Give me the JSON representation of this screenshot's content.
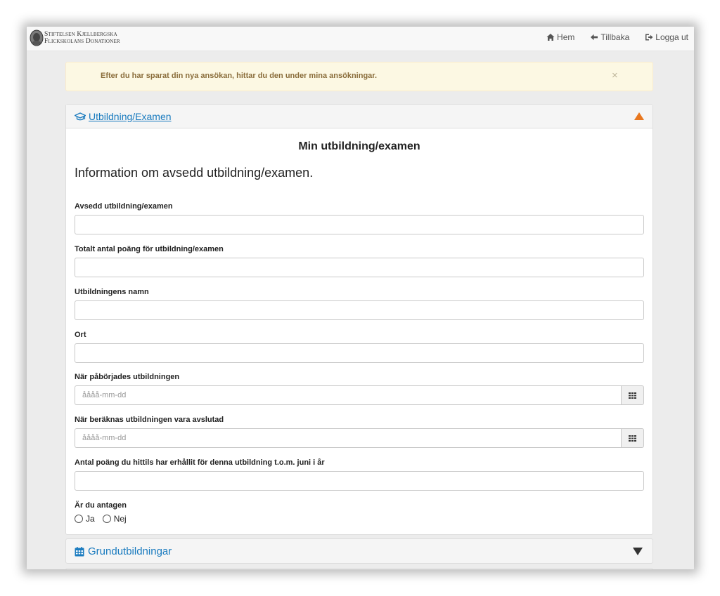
{
  "navbar": {
    "brand_line1": "Stiftelsen Kjellbergska",
    "brand_line2": "Flickskolans Donationer",
    "links": [
      {
        "label": "Hem",
        "icon": "home-icon"
      },
      {
        "label": "Tillbaka",
        "icon": "arrow-left-icon"
      },
      {
        "label": "Logga ut",
        "icon": "logout-icon"
      }
    ]
  },
  "alert": {
    "text": "Efter du har sparat din nya ansökan, hittar du den under mina ansökningar.",
    "close": "×"
  },
  "panel_education": {
    "title": "Utbildning/Examen",
    "icon": "graduation-cap-icon",
    "section_title": "Min utbildning/examen",
    "lead": "Information om avsedd utbildning/examen.",
    "fields": {
      "intended": {
        "label": "Avsedd utbildning/examen",
        "value": ""
      },
      "total_points": {
        "label": "Totalt antal poäng för utbildning/examen",
        "value": ""
      },
      "name": {
        "label": "Utbildningens namn",
        "value": ""
      },
      "city": {
        "label": "Ort",
        "value": ""
      },
      "start": {
        "label": "När påbörjades utbildningen",
        "placeholder": "åååå-mm-dd"
      },
      "end": {
        "label": "När beräknas utbildningen vara avslutad",
        "placeholder": "åååå-mm-dd"
      },
      "points_so_far": {
        "label": "Antal poäng du hittils har erhållit för denna utbildning t.o.m. juni i år",
        "value": ""
      }
    },
    "admitted": {
      "label": "Är du antagen",
      "options": [
        "Ja",
        "Nej"
      ]
    }
  },
  "panel_basic": {
    "title": "Grundutbildningar",
    "icon": "calendar-icon"
  },
  "colors": {
    "link": "#1a7bbf",
    "alert_bg": "#fcf8e3",
    "alert_text": "#8a6d3b",
    "toggle_active": "#e8771f"
  }
}
